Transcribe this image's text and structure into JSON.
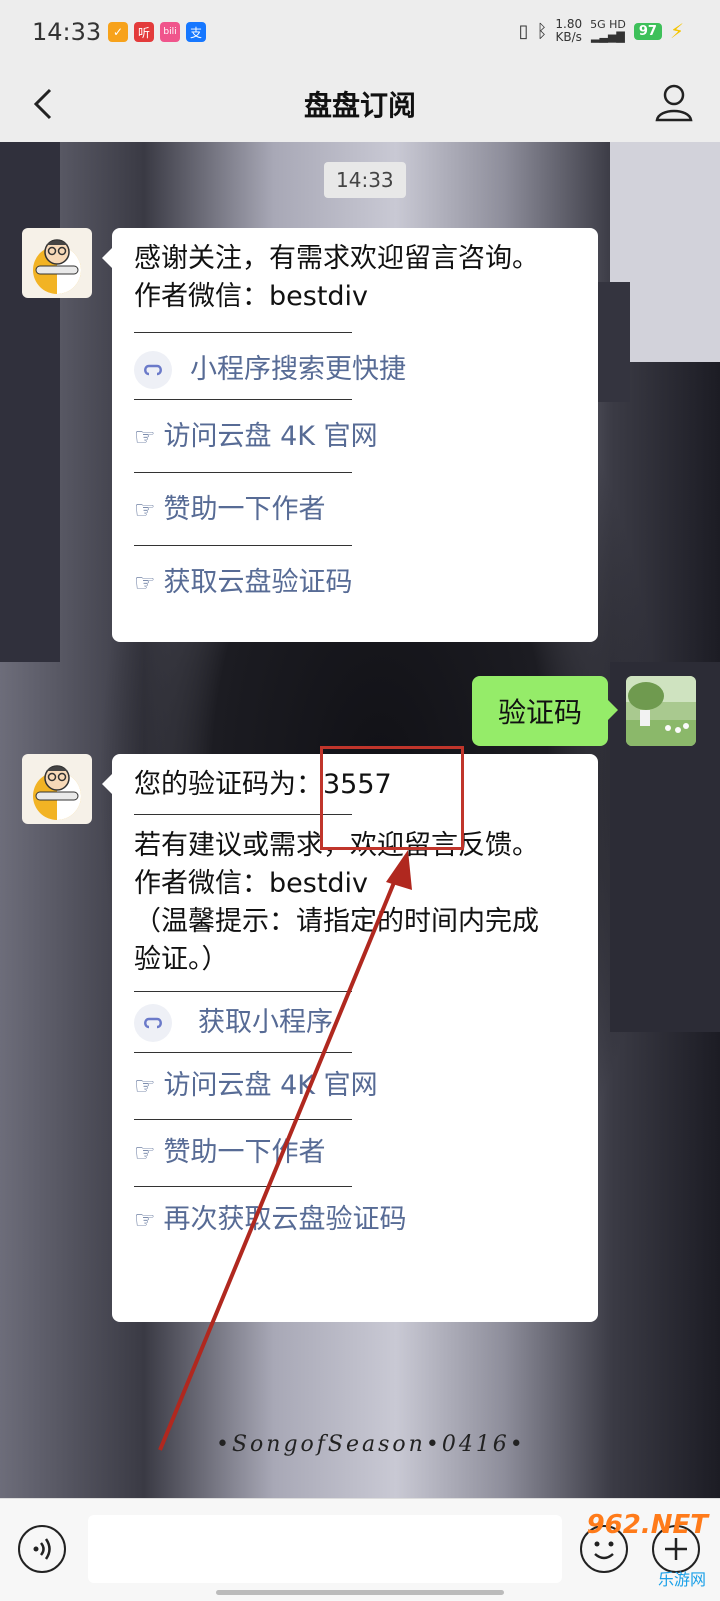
{
  "status_bar": {
    "time": "14:33",
    "apps": [
      "听",
      "bili",
      "支"
    ],
    "speed": "1.80",
    "speed_unit": "KB/s",
    "net": "5G HD",
    "battery": "97"
  },
  "navbar": {
    "title": "盘盘订阅"
  },
  "chat": {
    "timestamp": "14:33",
    "msg1": {
      "line1": "感谢关注，有需求欢迎留言咨询。",
      "line2": "作者微信：bestdiv",
      "link1": "小程序搜索更快捷",
      "link2": "访问云盘 4K 官网",
      "link3": "赞助一下作者",
      "link4": "获取云盘验证码"
    },
    "my_msg": "验证码",
    "msg2": {
      "code_line": "您的验证码为：3557",
      "line2": "若有建议或需求，欢迎留言反馈。",
      "line3": "作者微信：bestdiv",
      "line4": "（温馨提示：请指定的时间内完成",
      "line5": "验证。）",
      "link1": "获取小程序",
      "link2": "访问云盘 4K 官网",
      "link3": "赞助一下作者",
      "link4": "再次获取云盘验证码"
    },
    "hand_symbol": "☞",
    "background_caption": "•SongofSeason•0416•"
  },
  "watermark": {
    "logo": "962.NET",
    "site": "乐游网"
  },
  "colors": {
    "link": "#576b95",
    "my_bubble": "#95ec69",
    "annotation": "#c0352b"
  }
}
